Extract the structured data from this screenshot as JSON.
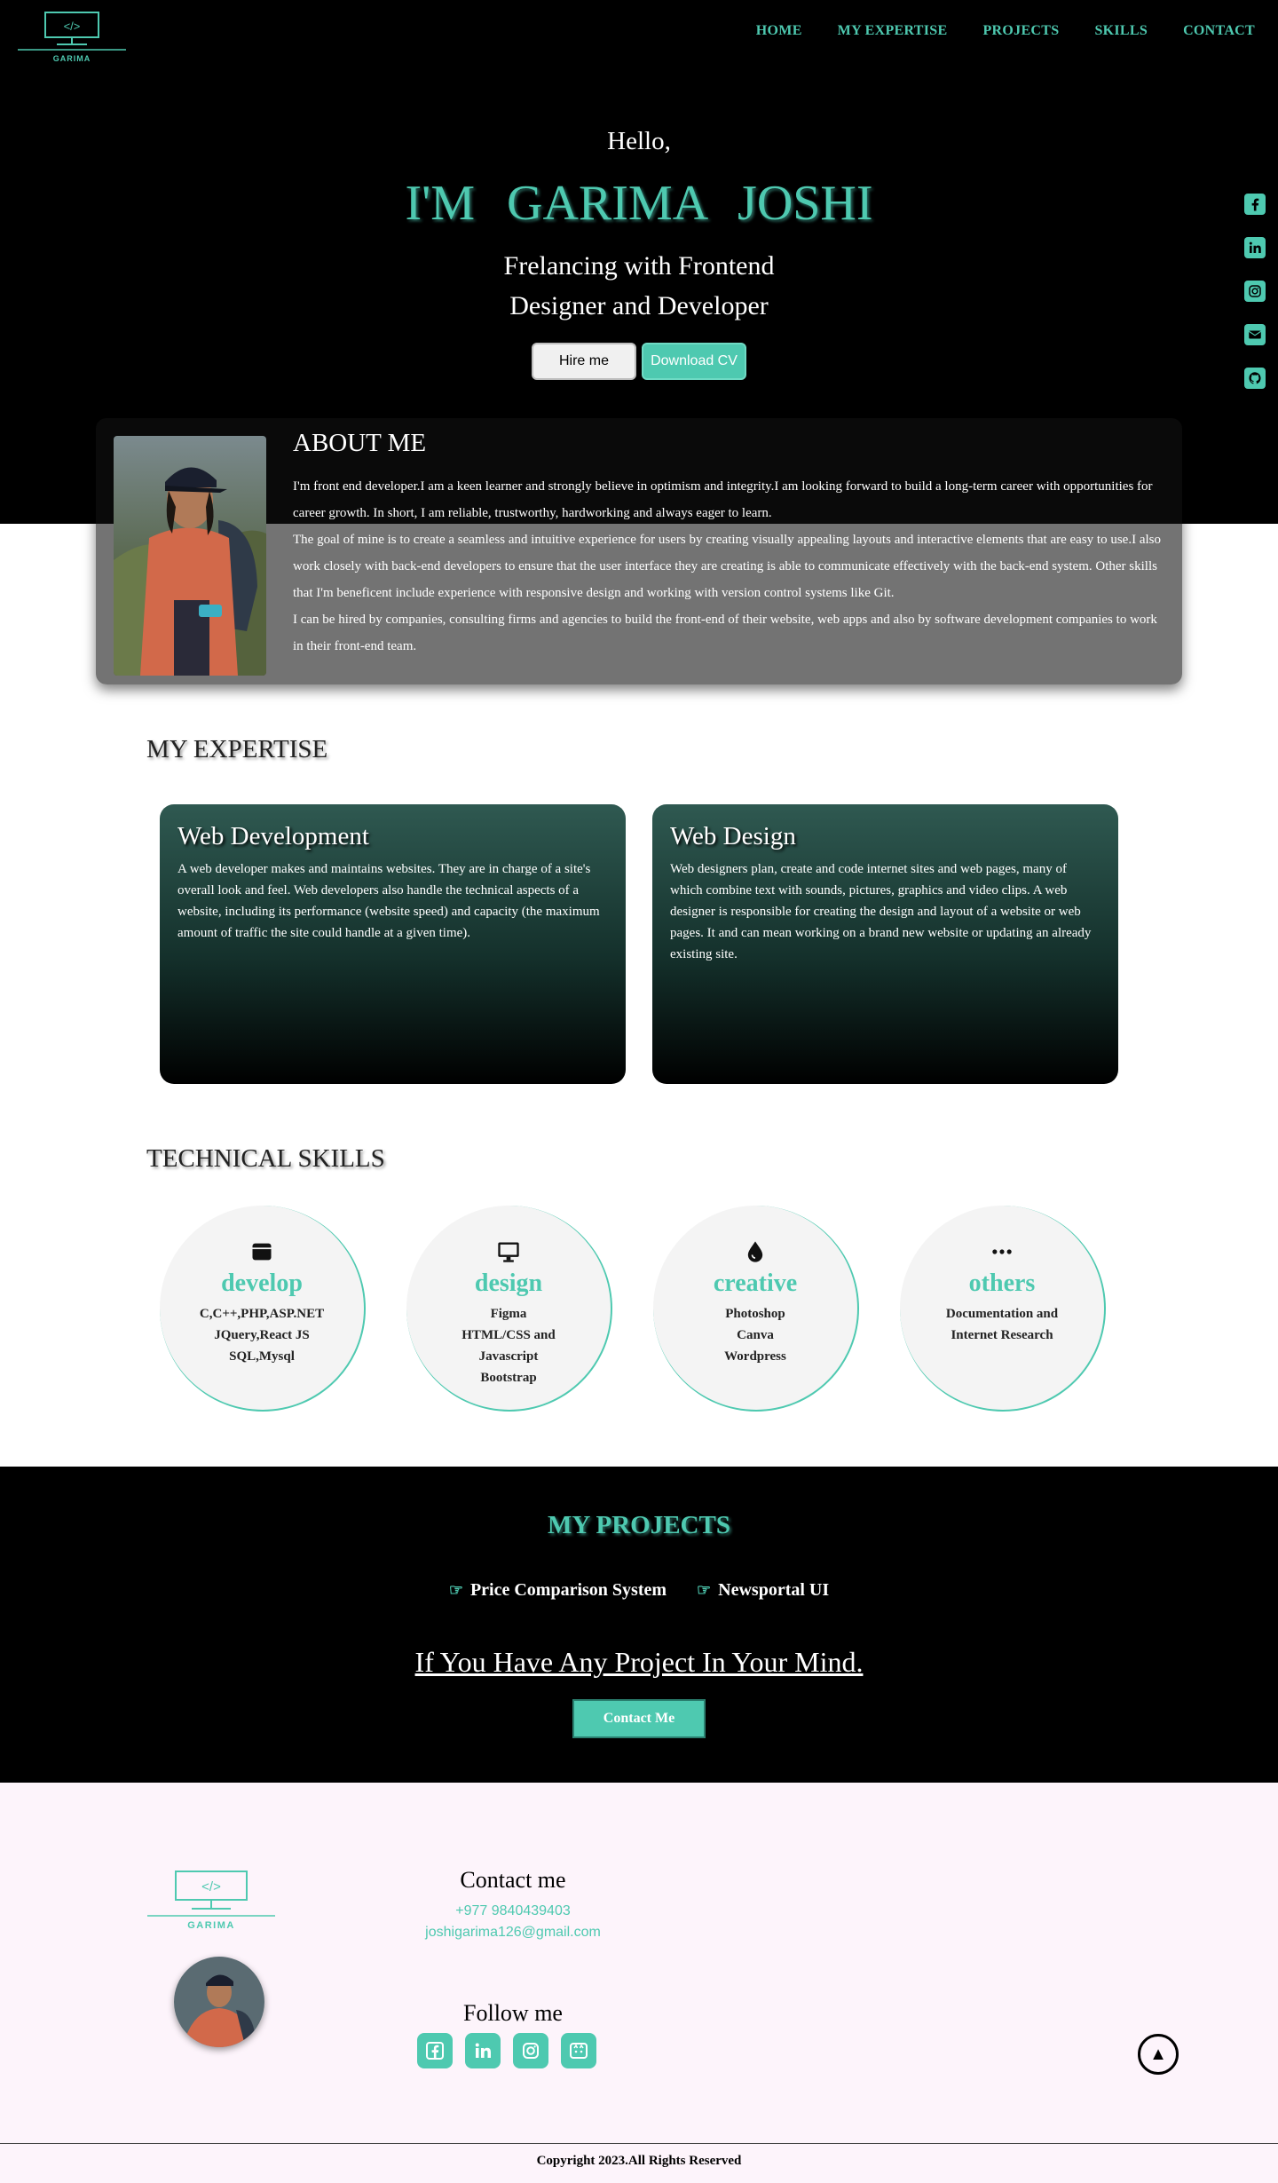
{
  "header": {
    "logo_text": "GARIMA",
    "logo_code": "</>",
    "nav": [
      "HOME",
      "MY EXPERTISE",
      "PROJECTS",
      "SKILLS",
      "CONTACT"
    ]
  },
  "hero": {
    "greeting": "Hello,",
    "name": "I'M GARIMA JOSHI",
    "tagline_1": "Frelancing with Frontend",
    "tagline_2": "Designer and Developer",
    "hire_label": "Hire me",
    "cv_label": "Download CV"
  },
  "social_side": [
    "facebook-icon",
    "linkedin-icon",
    "instagram-icon",
    "email-icon",
    "github-icon"
  ],
  "about": {
    "title": "ABOUT ME",
    "paragraphs": [
      "I'm front end developer.I am a keen learner and strongly believe in optimism and integrity.I am looking forward to build a long-term career with opportunities for career growth. In short, I am reliable, trustworthy, hardworking and always eager to learn.",
      "The goal of mine is to create a seamless and intuitive experience for users by creating visually appealing layouts and interactive elements that are easy to use.I also work closely with back-end developers to ensure that the user interface they are creating is able to communicate effectively with the back-end system. Other skills that I'm beneficent include experience with responsive design and working with version control systems like Git.",
      "I can be hired by companies, consulting firms and agencies to build the front-end of their website, web apps and also by software development companies to work in their front-end team."
    ]
  },
  "expertise": {
    "title": "MY EXPERTISE",
    "cards": [
      {
        "title": "Web Development",
        "text": "A web developer makes and maintains websites. They are in charge of a site's overall look and feel. Web developers also handle the technical aspects of a website, including its performance (website speed) and capacity (the maximum amount of traffic the site could handle at a given time)."
      },
      {
        "title": "Web Design",
        "text": "Web designers plan, create and code internet sites and web pages, many of which combine text with sounds, pictures, graphics and video clips. A web designer is responsible for creating the design and layout of a website or web pages. It and can mean working on a brand new website or updating an already existing site."
      }
    ]
  },
  "skills": {
    "title": "TECHNICAL SKILLS",
    "items": [
      {
        "icon": "browser-window-icon",
        "title": "develop",
        "body": "C,C++,PHP,ASP.NET\nJQuery,React JS\nSQL,Mysql"
      },
      {
        "icon": "monitor-icon",
        "title": "design",
        "body": "Figma\nHTML/CSS and\nJavascript\nBootstrap"
      },
      {
        "icon": "droplet-icon",
        "title": "creative",
        "body": "Photoshop\nCanva\nWordpress"
      },
      {
        "icon": "ellipsis-icon",
        "title": "others",
        "body": "Documentation and\nInternet Research"
      }
    ]
  },
  "projects": {
    "title": "MY PROJECTS",
    "items": [
      "Price Comparison System",
      "Newsportal UI"
    ],
    "cta": "If You Have Any Project In Your Mind.",
    "contact_label": "Contact Me"
  },
  "footer": {
    "contact_title": "Contact me",
    "phone": "+977 9840439403",
    "email": "joshigarima126@gmail.com",
    "follow_title": "Follow me",
    "follow_icons": [
      "facebook-icon",
      "linkedin-icon",
      "instagram-icon",
      "github-icon"
    ],
    "copyright": "Copyright 2023.All Rights Reserved"
  },
  "colors": {
    "accent": "#4ec9b0",
    "hero_bg": "#000000",
    "footer_bg": "#fdf4fb"
  }
}
